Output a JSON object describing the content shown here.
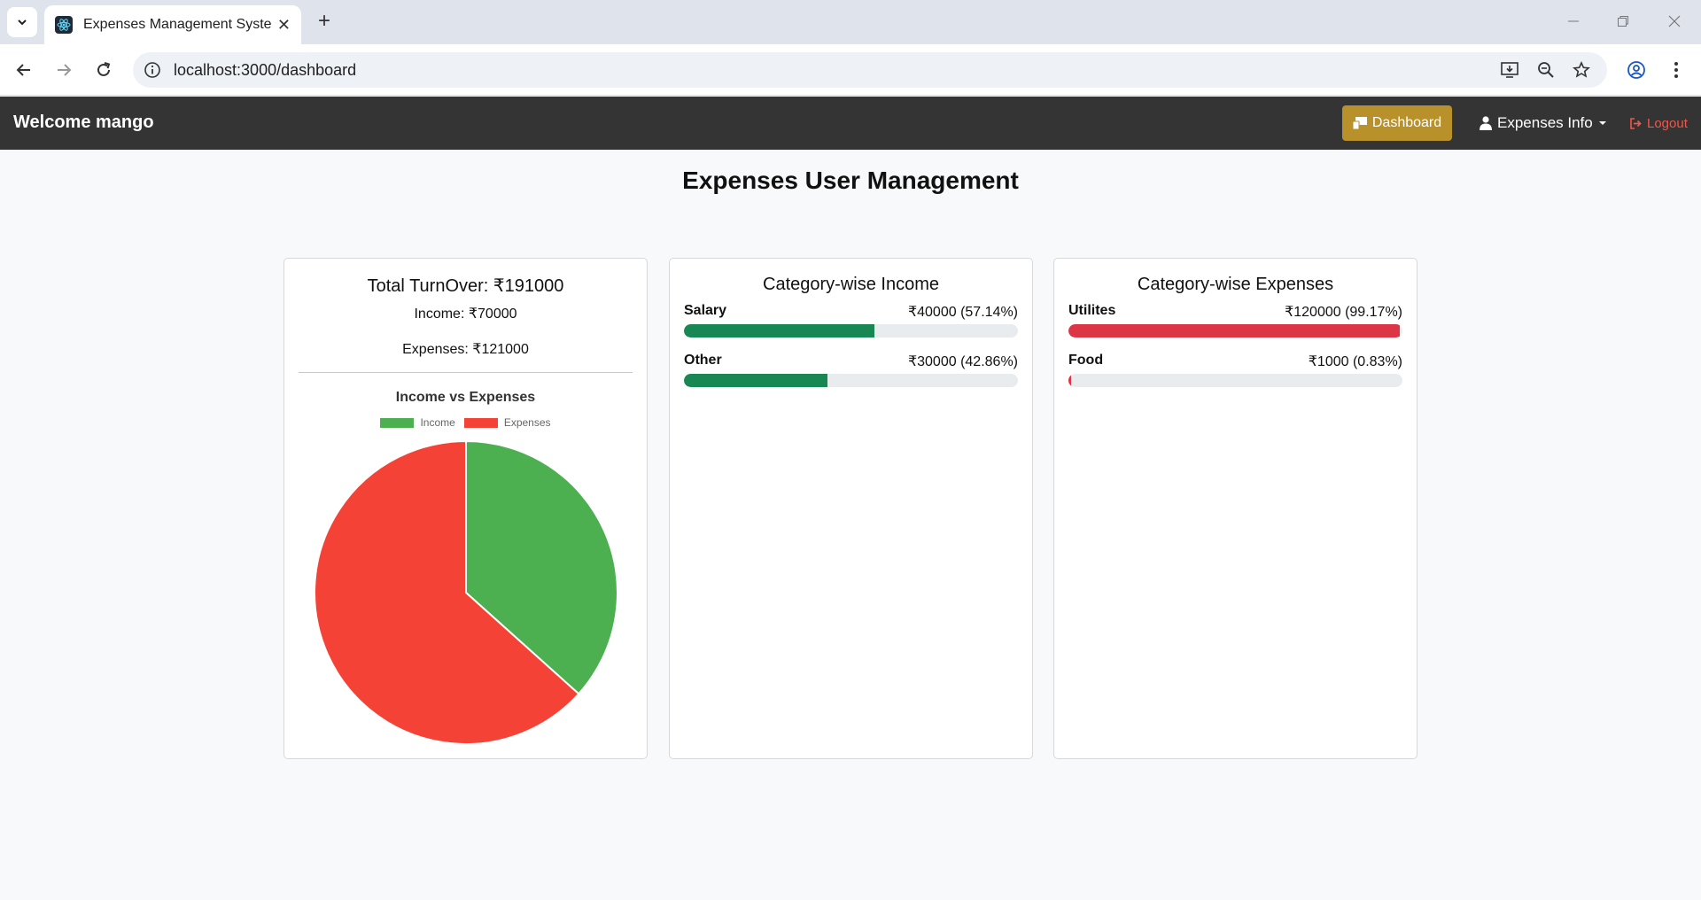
{
  "browser": {
    "tab_title": "Expenses Management System",
    "url": "localhost:3000/dashboard"
  },
  "navbar": {
    "brand": "Welcome mango",
    "dashboard_label": "Dashboard",
    "expenses_info_label": "Expenses Info",
    "logout_label": "Logout",
    "dashboard_color": "#b8912b"
  },
  "page": {
    "title": "Expenses User Management"
  },
  "turnover_card": {
    "title": "Total TurnOver: ₹191000",
    "income_line": "Income: ₹70000",
    "expenses_line": "Expenses: ₹121000"
  },
  "chart_data": {
    "type": "pie",
    "title": "Income vs Expenses",
    "categories": [
      "Income",
      "Expenses"
    ],
    "values": [
      70000,
      121000
    ],
    "colors": [
      "#4caf50",
      "#f44336"
    ],
    "legend_position": "top"
  },
  "income_card": {
    "title": "Category-wise Income",
    "bar_color": "#198754",
    "items": [
      {
        "name": "Salary",
        "value": "₹40000 (57.14%)",
        "percent": 57.14
      },
      {
        "name": "Other",
        "value": "₹30000 (42.86%)",
        "percent": 42.86
      }
    ]
  },
  "expenses_card": {
    "title": "Category-wise Expenses",
    "bar_color": "#dc3545",
    "items": [
      {
        "name": "Utilites",
        "value": "₹120000 (99.17%)",
        "percent": 99.17
      },
      {
        "name": "Food",
        "value": "₹1000 (0.83%)",
        "percent": 0.83
      }
    ]
  }
}
